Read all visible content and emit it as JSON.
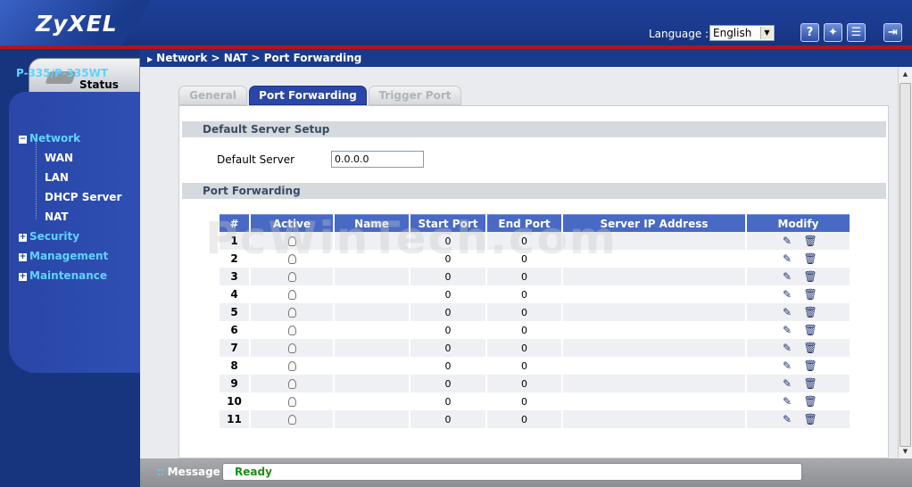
{
  "header": {
    "logo": "ZyXEL",
    "language_label": "Language :",
    "language_selected": "English",
    "icons": [
      "help-icon",
      "wizard-icon",
      "sitemap-icon",
      "logout-icon"
    ]
  },
  "nav": {
    "status_tab": "Status",
    "model": "P-335/P-335WT",
    "items": [
      {
        "label": "Network",
        "expanded": true
      },
      {
        "label": "WAN"
      },
      {
        "label": "LAN"
      },
      {
        "label": "DHCP Server"
      },
      {
        "label": "NAT"
      },
      {
        "label": "Security"
      },
      {
        "label": "Management"
      },
      {
        "label": "Maintenance"
      }
    ]
  },
  "breadcrumb": "Network > NAT > Port Forwarding",
  "tabs": [
    {
      "label": "General",
      "active": false
    },
    {
      "label": "Port Forwarding",
      "active": true
    },
    {
      "label": "Trigger Port",
      "active": false
    }
  ],
  "default_server": {
    "section_title": "Default Server Setup",
    "label": "Default Server",
    "value": "0.0.0.0"
  },
  "port_forwarding": {
    "section_title": "Port Forwarding",
    "columns": [
      "#",
      "Active",
      "Name",
      "Start Port",
      "End Port",
      "Server IP Address",
      "Modify"
    ],
    "rows": [
      {
        "num": "1",
        "name": "",
        "start": "0",
        "end": "0",
        "ip": ""
      },
      {
        "num": "2",
        "name": "",
        "start": "0",
        "end": "0",
        "ip": ""
      },
      {
        "num": "3",
        "name": "",
        "start": "0",
        "end": "0",
        "ip": ""
      },
      {
        "num": "4",
        "name": "",
        "start": "0",
        "end": "0",
        "ip": ""
      },
      {
        "num": "5",
        "name": "",
        "start": "0",
        "end": "0",
        "ip": ""
      },
      {
        "num": "6",
        "name": "",
        "start": "0",
        "end": "0",
        "ip": ""
      },
      {
        "num": "7",
        "name": "",
        "start": "0",
        "end": "0",
        "ip": ""
      },
      {
        "num": "8",
        "name": "",
        "start": "0",
        "end": "0",
        "ip": ""
      },
      {
        "num": "9",
        "name": "",
        "start": "0",
        "end": "0",
        "ip": ""
      },
      {
        "num": "10",
        "name": "",
        "start": "0",
        "end": "0",
        "ip": ""
      },
      {
        "num": "11",
        "name": "",
        "start": "0",
        "end": "0",
        "ip": ""
      }
    ]
  },
  "watermark": "PcWinTech.com",
  "footer": {
    "message_label": "Message",
    "message": "Ready"
  },
  "colors": {
    "brand_blue": "#1a3a8c",
    "header_red": "#b3141b",
    "nav_link": "#5fd3ff",
    "table_header": "#4869c4",
    "ready_green": "#1a8f1a"
  }
}
